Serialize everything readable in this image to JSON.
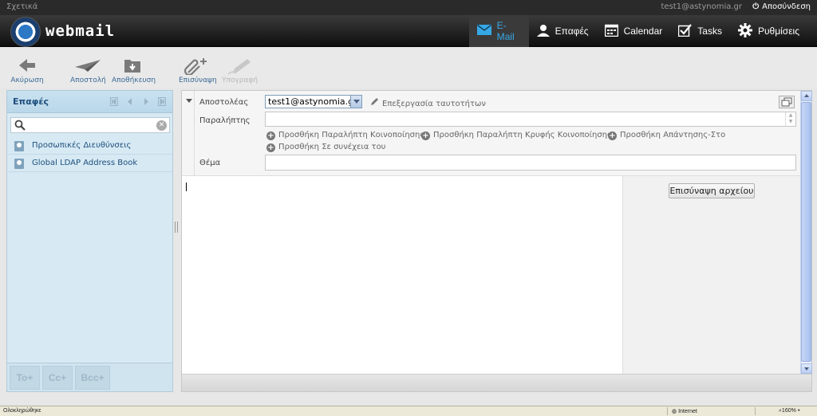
{
  "topbar": {
    "about": "Σχετικά",
    "user_email": "test1@astynomia.gr",
    "logout": "Αποσύνδεση"
  },
  "header": {
    "app_name": "webmail",
    "nav": [
      {
        "label": "E-Mail",
        "icon": "envelope-icon",
        "active": true
      },
      {
        "label": "Επαφές",
        "icon": "person-icon"
      },
      {
        "label": "Calendar",
        "icon": "calendar-icon"
      },
      {
        "label": "Tasks",
        "icon": "checkbox-icon"
      },
      {
        "label": "Ρυθμίσεις",
        "icon": "gear-icon"
      }
    ]
  },
  "toolbar": {
    "cancel": "Ακύρωση",
    "send": "Αποστολή",
    "save": "Αποθήκευση",
    "attach": "Επισύναψη",
    "signature": "Υπογραφή"
  },
  "contacts_panel": {
    "title": "Επαφές",
    "search_value": "",
    "address_books": [
      {
        "label": "Προσωπικές Διευθύνσεις"
      },
      {
        "label": "Global LDAP Address Book"
      }
    ],
    "add_to": "To+",
    "add_cc": "Cc+",
    "add_bcc": "Bcc+"
  },
  "compose": {
    "from_label": "Αποστολέας",
    "from_value": "test1@astynomia.gr",
    "edit_identities": "Επεξεργασία ταυτοτήτων",
    "to_label": "Παραλήπτης",
    "to_value": "",
    "add_cc": "Προσθήκη Παραλήπτη Κοινοποίησης",
    "add_bcc": "Προσθήκη Παραλήπτη Κρυφής Κοινοποίησης",
    "add_reply_to": "Προσθήκη Απάντησης-Στο",
    "add_followup": "Προσθήκη Σε συνέχεια του",
    "subject_label": "Θέμα",
    "subject_value": "",
    "body_value": "",
    "attach_file": "Επισύναψη αρχείου"
  },
  "statusbar": {
    "status": "Ολοκληρώθηκε",
    "zone": "Internet",
    "zoom": "160%"
  },
  "colors": {
    "accent": "#37a8e6",
    "panel_bg": "#d7eaf4",
    "header_bg": "#1a1a1a"
  }
}
